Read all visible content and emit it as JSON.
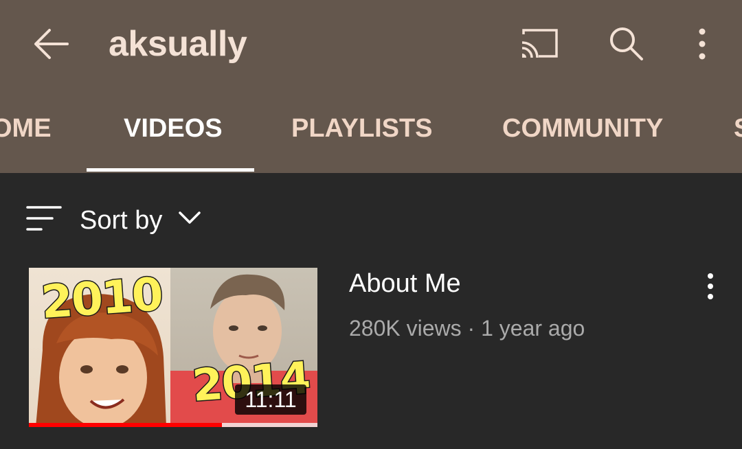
{
  "header": {
    "title": "aksually",
    "icons": {
      "back": "arrow-back-icon",
      "cast": "cast-icon",
      "search": "search-icon",
      "more": "more-vertical-icon"
    }
  },
  "tabs": [
    {
      "label": "HOME",
      "visible_text": "OME",
      "active": false
    },
    {
      "label": "VIDEOS",
      "active": true
    },
    {
      "label": "PLAYLISTS",
      "active": false
    },
    {
      "label": "COMMUNITY",
      "active": false
    },
    {
      "label": "STORE",
      "visible_text": "S",
      "active": false
    }
  ],
  "sort": {
    "label": "Sort by",
    "icon": "sort-icon",
    "chevron": "chevron-down-icon"
  },
  "videos": [
    {
      "title": "About Me",
      "meta": "280K views · 1 year ago",
      "duration": "11:11",
      "thumbnail_text_left": "2010",
      "thumbnail_text_right": "2014",
      "watch_progress": 0.67
    }
  ],
  "colors": {
    "header_bg": "#64574D",
    "body_bg": "#282828",
    "title": "#F4E2D6",
    "tab_inactive": "#F0D6C6",
    "tab_active": "#FFFFFF",
    "meta": "#AAAAAA",
    "progress": "#FF0000"
  }
}
